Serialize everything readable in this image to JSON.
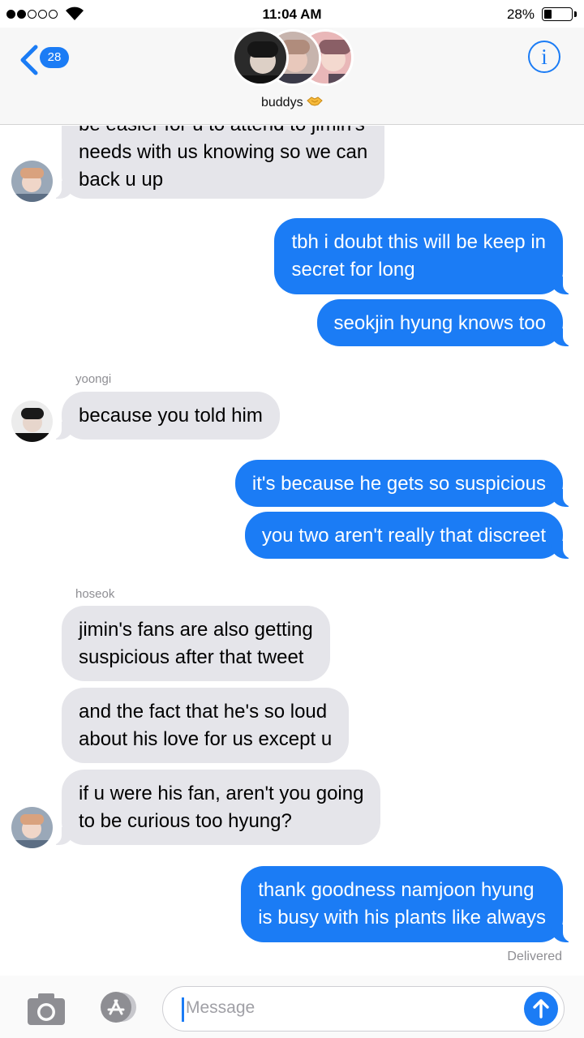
{
  "status_bar": {
    "time": "11:04 AM",
    "battery_percent_text": "28%",
    "battery_level": 0.28,
    "signal_bars_filled": 2,
    "signal_bars_total": 5
  },
  "header": {
    "back_badge": "28",
    "group_name": "buddys",
    "group_emoji_icon": "handshake-icon",
    "info_icon": "info-icon",
    "info_glyph": "i"
  },
  "messages": [
    {
      "direction": "incoming",
      "lines": [
        "be easier for u to attend to jimin's",
        "needs with us knowing so we can",
        "back u up"
      ]
    },
    {
      "direction": "outgoing",
      "lines": [
        "tbh i doubt this will be keep in",
        "secret for long"
      ]
    },
    {
      "direction": "outgoing",
      "lines": [
        "seokjin hyung knows too"
      ]
    },
    {
      "direction": "incoming",
      "sender": "yoongi",
      "lines": [
        "because you told him"
      ]
    },
    {
      "direction": "outgoing",
      "lines": [
        "it's because he gets so suspicious"
      ]
    },
    {
      "direction": "outgoing",
      "lines": [
        "you two aren't really that discreet"
      ]
    },
    {
      "direction": "incoming",
      "sender": "hoseok",
      "lines": [
        "jimin's fans are also getting",
        "suspicious after that tweet"
      ]
    },
    {
      "direction": "incoming",
      "lines": [
        "and the fact that he's so loud",
        "about his love for us except u"
      ]
    },
    {
      "direction": "incoming",
      "lines": [
        "if u were his fan, aren't you going",
        "to be curious too hyung?"
      ]
    },
    {
      "direction": "outgoing",
      "lines": [
        "thank goodness namjoon hyung",
        "is busy with his plants like always"
      ]
    }
  ],
  "delivered_label": "Delivered",
  "composer": {
    "placeholder": "Message",
    "camera_icon": "camera-icon",
    "apps_icon": "app-store-icon",
    "send_icon": "send-arrow-icon"
  },
  "colors": {
    "accent": "#1b7cf5",
    "incoming_bubble": "#e5e5ea",
    "outgoing_bubble": "#1b7cf5",
    "secondary_text": "#8e8e93"
  }
}
